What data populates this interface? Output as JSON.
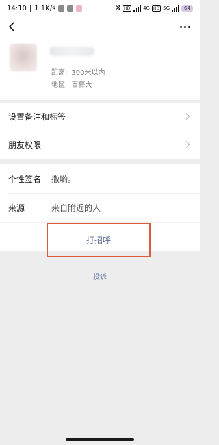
{
  "status_bar": {
    "time": "14:10",
    "speed": "1.1K/s",
    "network_tag": "4G",
    "network_tag2": "5G",
    "battery": "64"
  },
  "header": {
    "back_icon": "chevron-left-icon",
    "more_icon": "more-dots-icon"
  },
  "profile": {
    "distance_label": "距离:",
    "distance_value": "300米以内",
    "region_label": "地区:",
    "region_value": "百慕大"
  },
  "menu": {
    "remark_tags": "设置备注和标签",
    "friend_permissions": "朋友权限"
  },
  "details": {
    "signature_label": "个性签名",
    "signature_value": "撒哟。",
    "source_label": "来源",
    "source_value": "来自附近的人"
  },
  "actions": {
    "greet_label": "打招呼",
    "report_label": "投诉"
  },
  "colors": {
    "link_blue": "#576b95",
    "highlight_red": "#e05a3c",
    "background": "#ededed"
  }
}
